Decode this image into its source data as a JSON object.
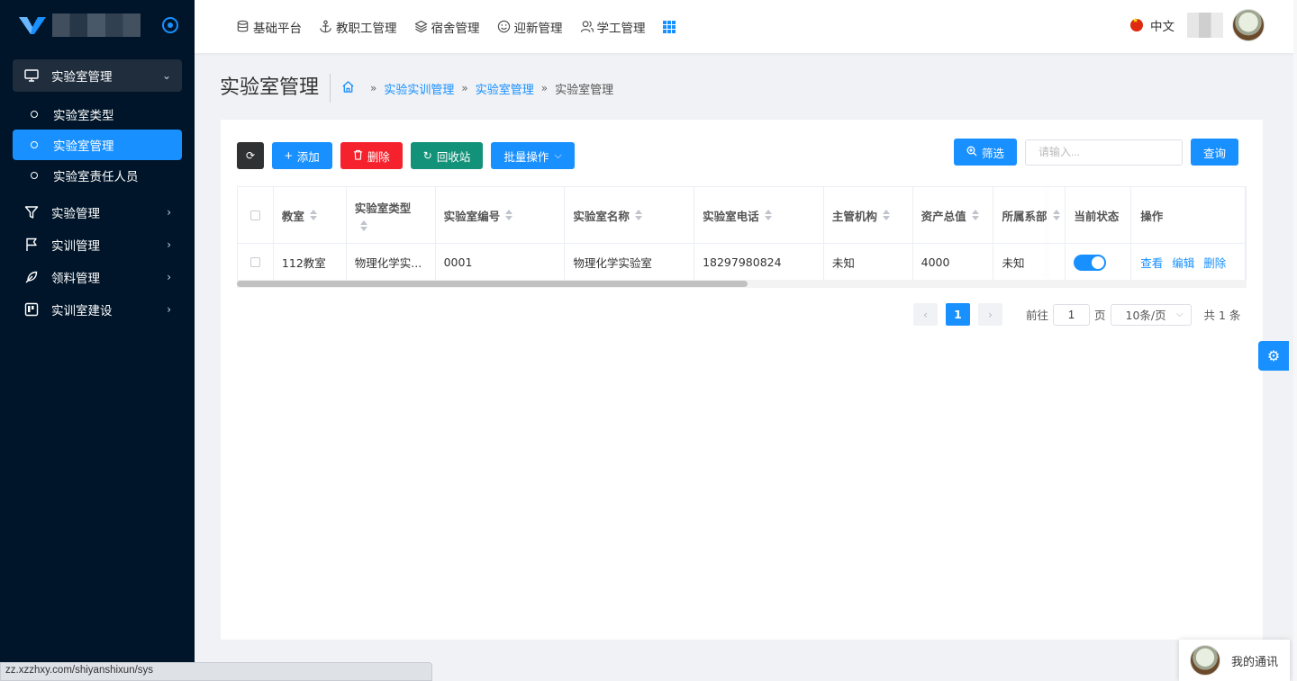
{
  "sidebar": {
    "groups": [
      {
        "label": "实验室管理",
        "icon": "monitor-icon",
        "expanded": true,
        "children": [
          {
            "label": "实验室类型"
          },
          {
            "label": "实验室管理",
            "active": true
          },
          {
            "label": "实验室责任人员"
          }
        ]
      },
      {
        "label": "实验管理",
        "icon": "filter-icon"
      },
      {
        "label": "实训管理",
        "icon": "flag-icon"
      },
      {
        "label": "领料管理",
        "icon": "feather-icon"
      },
      {
        "label": "实训室建设",
        "icon": "board-icon"
      }
    ]
  },
  "topnav": {
    "items": [
      {
        "label": "基础平台",
        "icon": "database-icon"
      },
      {
        "label": "教职工管理",
        "icon": "anchor-icon"
      },
      {
        "label": "宿舍管理",
        "icon": "layers-icon"
      },
      {
        "label": "迎新管理",
        "icon": "smile-icon"
      },
      {
        "label": "学工管理",
        "icon": "users-icon"
      }
    ],
    "language": "中文"
  },
  "page": {
    "title": "实验室管理",
    "breadcrumb": [
      "实验实训管理",
      "实验室管理",
      "实验室管理"
    ]
  },
  "toolbar": {
    "add": "添加",
    "delete": "删除",
    "recycle": "回收站",
    "batch": "批量操作",
    "filter": "筛选",
    "search_placeholder": "请输入...",
    "query": "查询"
  },
  "table": {
    "columns": [
      "教室",
      "实验室类型",
      "实验室编号",
      "实验室名称",
      "实验室电话",
      "主管机构",
      "资产总值",
      "所属系部",
      "当前状态",
      "操作"
    ],
    "rows": [
      {
        "room": "112教室",
        "type": "物理化学实...",
        "code": "0001",
        "name": "物理化学实验室",
        "phone": "18297980824",
        "org": "未知",
        "assets": "4000",
        "dept": "未知",
        "status_on": true
      }
    ],
    "actions": [
      "查看",
      "编辑",
      "删除"
    ]
  },
  "pagination": {
    "current": "1",
    "goto_label": "前往",
    "goto_value": "1",
    "page_suffix": "页",
    "page_size": "10条/页",
    "total": "共 1 条"
  },
  "chat": {
    "label": "我的通讯"
  },
  "status_url": "zz.xzzhxy.com/shiyanshixun/sys",
  "colors": {
    "sidebar_bg": "#001529",
    "primary": "#1890ff",
    "danger": "#f5222d",
    "success": "#13927a"
  }
}
